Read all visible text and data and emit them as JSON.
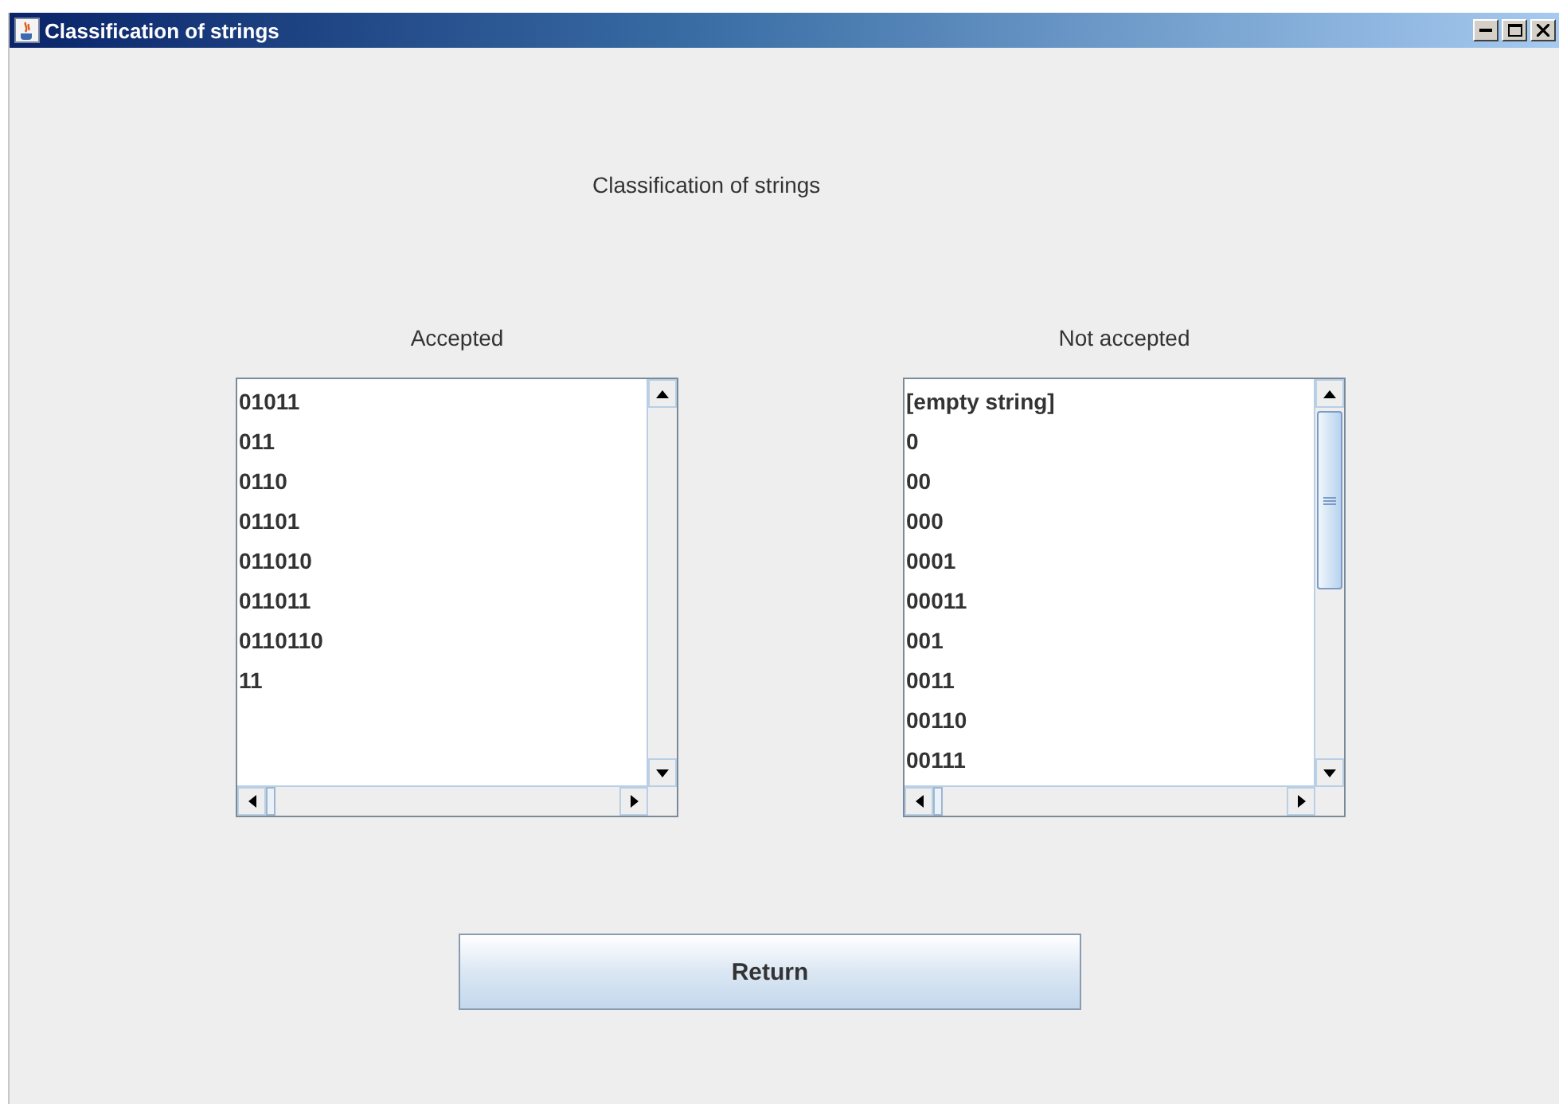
{
  "window": {
    "title": "Classification of strings"
  },
  "heading": "Classification of strings",
  "lists": [
    {
      "label": "Accepted",
      "items": [
        "01011",
        "011",
        "0110",
        "01101",
        "011010",
        "011011",
        "0110110",
        "11"
      ]
    },
    {
      "label": "Not accepted",
      "items": [
        "[empty string]",
        "0",
        "00",
        "000",
        "0001",
        "00011",
        "001",
        "0011",
        "00110",
        "00111"
      ]
    }
  ],
  "buttons": [
    "Return"
  ]
}
